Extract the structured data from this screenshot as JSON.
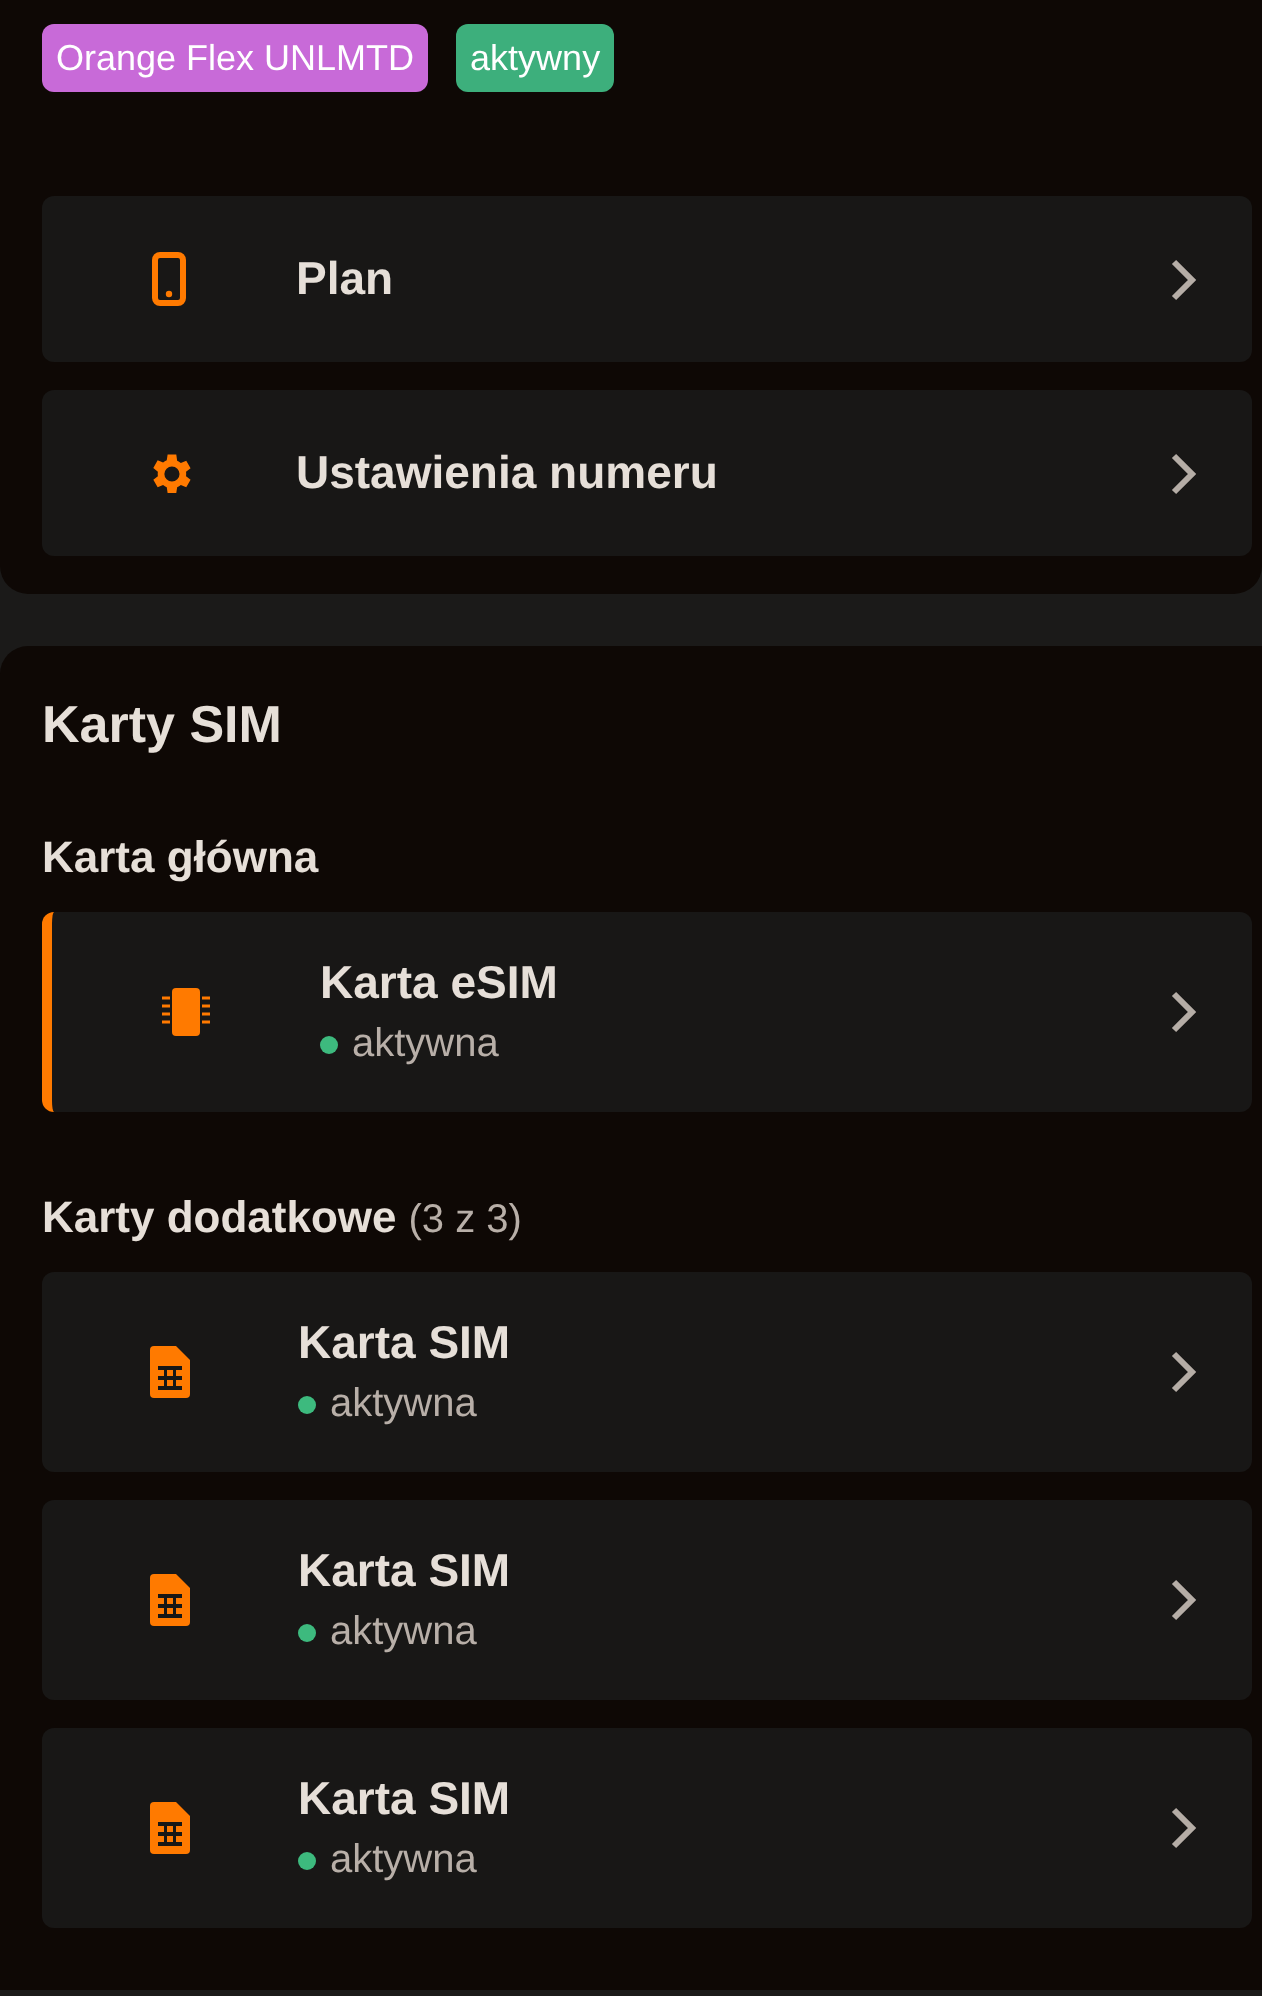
{
  "badges": [
    {
      "label": "Orange Flex UNLMTD",
      "color": "#c86ad8"
    },
    {
      "label": "aktywny",
      "color": "#3daf7c"
    }
  ],
  "menu": [
    {
      "kind": "phone",
      "label": "Plan"
    },
    {
      "kind": "gear",
      "label": "Ustawienia numeru"
    }
  ],
  "sim_section": {
    "title": "Karty SIM",
    "main": {
      "heading": "Karta główna",
      "cards": [
        {
          "kind": "esim",
          "name": "Karta eSIM",
          "status": "aktywna",
          "color": "#3dba7e"
        }
      ]
    },
    "extra": {
      "heading": "Karty dodatkowe",
      "count": "(3 z 3)",
      "cards": [
        {
          "kind": "sim",
          "name": "Karta SIM",
          "status": "aktywna",
          "color": "#3dba7e"
        },
        {
          "kind": "sim",
          "name": "Karta SIM",
          "status": "aktywna",
          "color": "#3dba7e"
        },
        {
          "kind": "sim",
          "name": "Karta SIM",
          "status": "aktywna",
          "color": "#3dba7e"
        }
      ]
    }
  }
}
